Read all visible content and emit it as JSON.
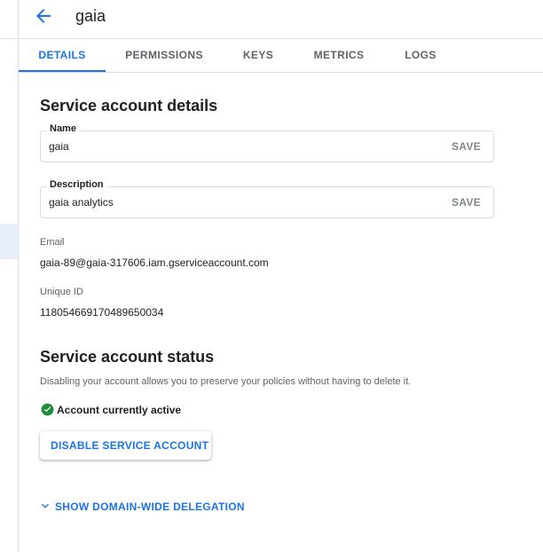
{
  "header": {
    "title": "gaia"
  },
  "tabs": [
    {
      "label": "DETAILS"
    },
    {
      "label": "PERMISSIONS"
    },
    {
      "label": "KEYS"
    },
    {
      "label": "METRICS"
    },
    {
      "label": "LOGS"
    }
  ],
  "details": {
    "section_title": "Service account details",
    "name": {
      "label": "Name",
      "value": "gaia",
      "save": "SAVE"
    },
    "description": {
      "label": "Description",
      "value": "gaia analytics",
      "save": "SAVE"
    },
    "email": {
      "label": "Email",
      "value": "gaia-89@gaia-317606.iam.gserviceaccount.com"
    },
    "unique_id": {
      "label": "Unique ID",
      "value": "118054669170489650034"
    }
  },
  "status": {
    "section_title": "Service account status",
    "description": "Disabling your account allows you to preserve your policies without having to delete it.",
    "state": "Account currently active",
    "disable_button": "DISABLE SERVICE ACCOUNT"
  },
  "delegation": {
    "label": "SHOW DOMAIN-WIDE DELEGATION"
  },
  "colors": {
    "accent": "#1a73e8",
    "success": "#1e8e3e",
    "border": "#dadce0"
  },
  "icons": {
    "back": "arrow-back-icon",
    "status": "check-circle-icon",
    "expand": "chevron-down-icon"
  }
}
